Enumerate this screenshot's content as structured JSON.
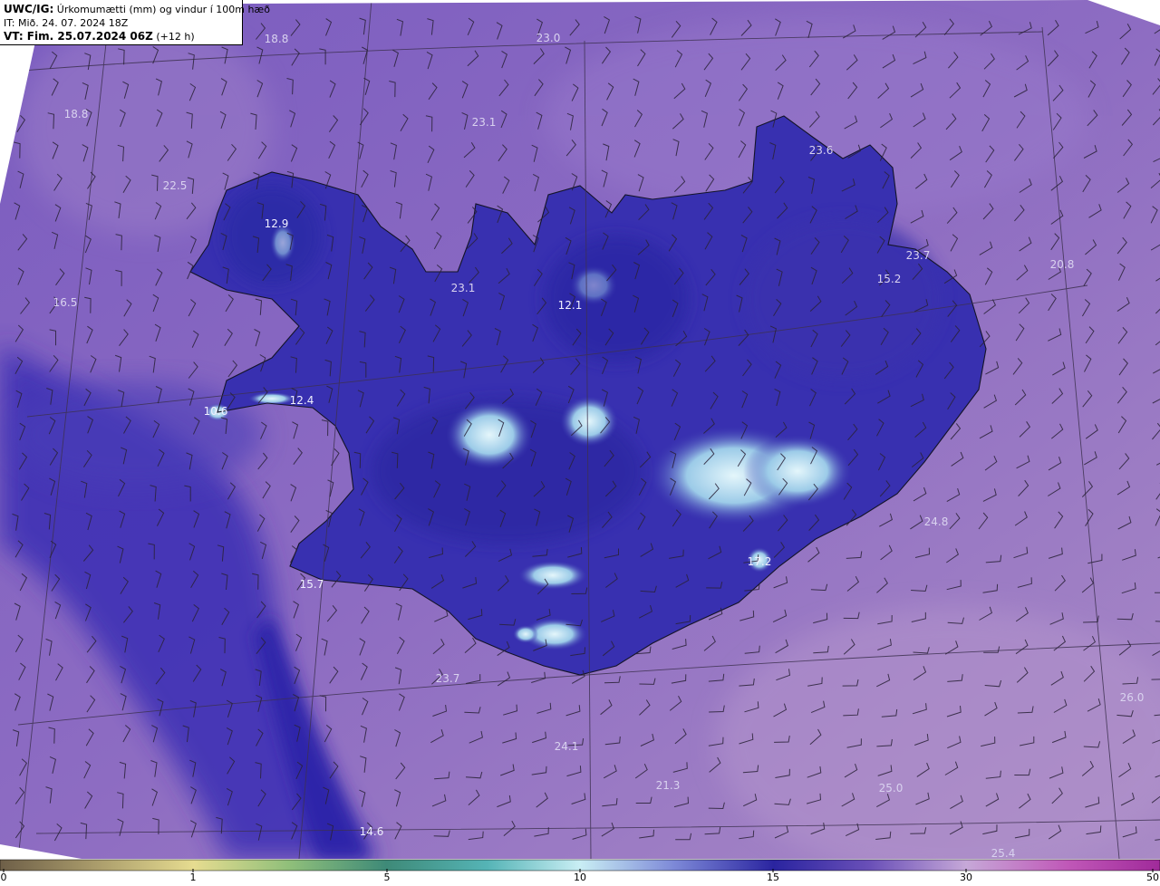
{
  "header": {
    "product": "UWC/IG:",
    "description": "Úrkomumætti (mm) og vindur í 100m hæð",
    "it_line": "IT: Mið. 24. 07. 2024 18Z",
    "vt_label": "VT: Fim. 25.07.2024 06Z",
    "vt_suffix": " (+12 h)"
  },
  "colors": {
    "ocean_base": "#8a66c0",
    "ocean_light": "#a884c8",
    "moisture_band": "#3a2fb0",
    "land_dark": "#2c2aa6",
    "high_precip": "#c8ecf4",
    "coast": "#1a1a2e",
    "grid": "#3d3150",
    "barb": "#2a2238",
    "label_light": "#d9d2ef",
    "label_dark": "#f0f0ff"
  },
  "map_labels": [
    {
      "text": "18.8"
    },
    {
      "text": "23.0"
    },
    {
      "text": "18.8"
    },
    {
      "text": "23.1"
    },
    {
      "text": "23.6"
    },
    {
      "text": "22.5"
    },
    {
      "text": "12.9"
    },
    {
      "text": "23.7"
    },
    {
      "text": "20.8"
    },
    {
      "text": "16.5"
    },
    {
      "text": "23.1"
    },
    {
      "text": "12.1"
    },
    {
      "text": "15.2"
    },
    {
      "text": "12.4"
    },
    {
      "text": "10.6"
    },
    {
      "text": "24.8"
    },
    {
      "text": "15.7"
    },
    {
      "text": "17.2"
    },
    {
      "text": "23.7"
    },
    {
      "text": "26.0"
    },
    {
      "text": "24.1"
    },
    {
      "text": "21.3"
    },
    {
      "text": "25.0"
    },
    {
      "text": "14.6"
    },
    {
      "text": "25.4"
    }
  ],
  "colorbar": {
    "ticks": [
      {
        "label": "0",
        "value": 0
      },
      {
        "label": "1",
        "value": 1
      },
      {
        "label": "5",
        "value": 5
      },
      {
        "label": "10",
        "value": 10
      },
      {
        "label": "15",
        "value": 15
      },
      {
        "label": "30",
        "value": 30
      },
      {
        "label": "50",
        "value": 50
      }
    ],
    "stops": [
      "#7a6a4e",
      "#d9d08a",
      "#4e9a78",
      "#bde8f2",
      "#2a2aa0",
      "#a07ac8",
      "#b03aa8"
    ]
  }
}
